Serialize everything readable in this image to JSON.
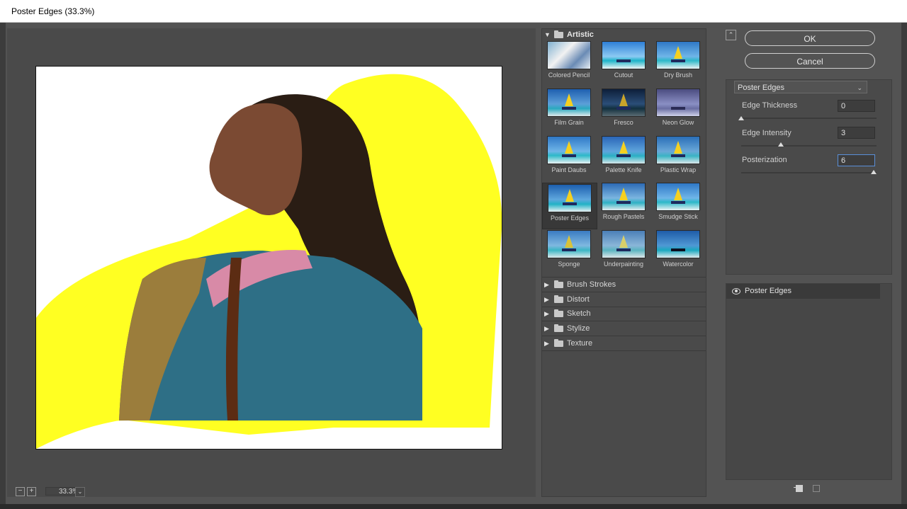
{
  "window": {
    "title": "Poster Edges (33.3%)"
  },
  "zoom": {
    "value": "33.3%",
    "minus": "−",
    "plus": "+"
  },
  "gallery": {
    "categories": [
      {
        "name": "Artistic",
        "expanded": true
      },
      {
        "name": "Brush Strokes",
        "expanded": false
      },
      {
        "name": "Distort",
        "expanded": false
      },
      {
        "name": "Sketch",
        "expanded": false
      },
      {
        "name": "Stylize",
        "expanded": false
      },
      {
        "name": "Texture",
        "expanded": false
      }
    ],
    "artistic_filters": [
      "Colored Pencil",
      "Cutout",
      "Dry Brush",
      "Film Grain",
      "Fresco",
      "Neon Glow",
      "Paint Daubs",
      "Palette Knife",
      "Plastic Wrap",
      "Poster Edges",
      "Rough Pastels",
      "Smudge Stick",
      "Sponge",
      "Underpainting",
      "Watercolor"
    ],
    "selected_filter": "Poster Edges"
  },
  "buttons": {
    "ok": "OK",
    "cancel": "Cancel"
  },
  "settings": {
    "filter": "Poster Edges",
    "params": [
      {
        "label": "Edge Thickness",
        "value": "0",
        "level": 0.0
      },
      {
        "label": "Edge Intensity",
        "value": "3",
        "level": 0.3
      },
      {
        "label": "Posterization",
        "value": "6",
        "level": 1.0
      }
    ]
  },
  "layers": {
    "items": [
      {
        "name": "Poster Edges",
        "visible": true
      }
    ]
  },
  "colors": {
    "accent_focus": "#5a8fd8",
    "yellow": "#ffff22"
  }
}
